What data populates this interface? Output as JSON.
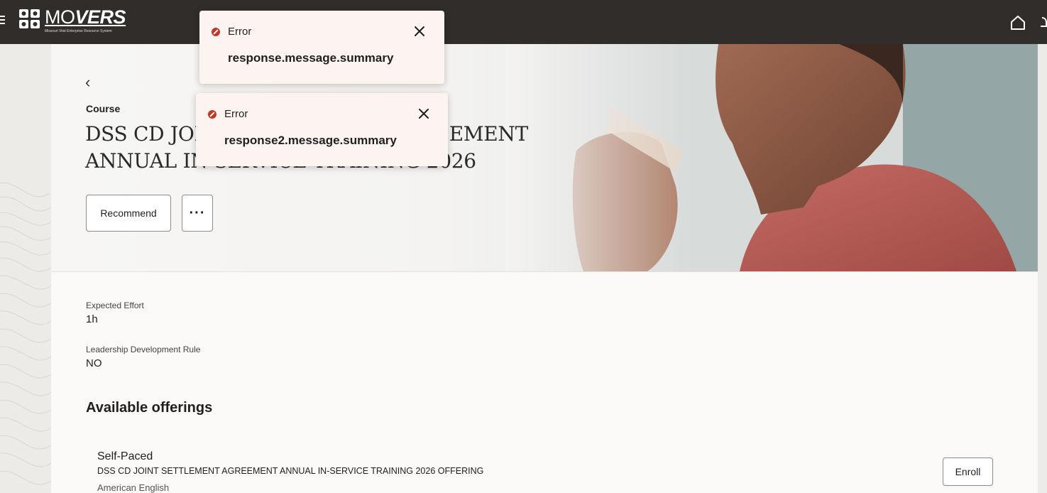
{
  "app": {
    "logo_text_light": "MO",
    "logo_text_bold": "VERS",
    "logo_tagline": "Missouri Vital Enterprise Resource System"
  },
  "icons": {
    "menu": "hamburger-menu-icon",
    "home": "home-icon",
    "back": "chevron-left-icon",
    "more": "ellipsis-icon",
    "error": "error-icon",
    "close": "close-icon"
  },
  "toasts": [
    {
      "heading": "Error",
      "message": "response.message.summary"
    },
    {
      "heading": "Error",
      "message": "response2.message.summary"
    }
  ],
  "hero": {
    "back_label": "‹",
    "eyebrow": "Course",
    "title": "DSS CD JOINT SETTLEMENT AGREEMENT ANNUAL IN-SERVICE TRAINING 2026",
    "recommend_label": "Recommend",
    "more_label": "···"
  },
  "attributes": [
    {
      "label": "Expected Effort",
      "value": "1h"
    },
    {
      "label": "Leadership Development Rule",
      "value": "NO"
    }
  ],
  "offerings": {
    "heading": "Available offerings",
    "items": [
      {
        "type": "Self-Paced",
        "title": "DSS CD JOINT SETTLEMENT AGREEMENT ANNUAL IN-SERVICE TRAINING 2026 OFFERING",
        "language": "American English",
        "action_label": "Enroll"
      }
    ]
  },
  "colors": {
    "topbar": "#312d2a",
    "error": "#c0392b",
    "toast_bg": "#fdf4f2",
    "page_bg": "#faf9f7"
  }
}
